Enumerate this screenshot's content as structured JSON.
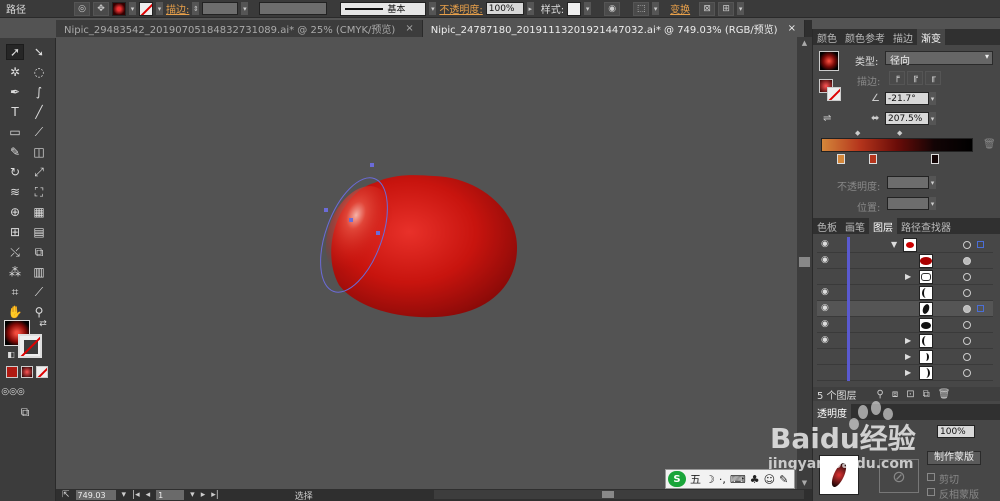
{
  "control_bar": {
    "object_type": "路径",
    "stroke_label": "描边:",
    "stroke_style": "基本",
    "opacity_label": "不透明度:",
    "opacity_value": "100%",
    "style_label": "样式:",
    "transform_label": "变换"
  },
  "tabs": [
    {
      "label": "Nipic_29483542_20190705184832731089.ai* @ 25% (CMYK/预览)",
      "close": "×"
    },
    {
      "label": "Nipic_24787180_20191113201921447032.ai* @ 749.03% (RGB/预览)",
      "close": "×"
    }
  ],
  "status_bar": {
    "zoom": "749.03",
    "page": "1",
    "tool": "选择"
  },
  "right_panel": {
    "top_tabs": [
      "颜色",
      "颜色参考",
      "描边",
      "渐变"
    ],
    "gradient": {
      "type_label": "类型:",
      "type_value": "径向",
      "stroke_label": "描边:",
      "angle": "-21.7°",
      "aspect": "207.5%",
      "opacity_label": "不透明度:",
      "location_label": "位置:",
      "colors": [
        "#d4873a",
        "#b5351c",
        "#6a0c08",
        "#120405",
        "#000000"
      ]
    },
    "layer_tabs": [
      "色板",
      "画笔",
      "图层",
      "路径查找器"
    ],
    "layers_count": "5 个图层",
    "transparency_tab": "透明度",
    "opacity_value": "100%",
    "make_mask": "制作蒙版",
    "clip_label": "剪切",
    "invert_label": "反相蒙版"
  },
  "ime": {
    "label": "五"
  },
  "watermark": {
    "brand": "Baidu经验",
    "url": "jingyan.baidu.com"
  },
  "colors": {
    "apple_light": "#e8312a",
    "apple_mid": "#c8140e",
    "apple_dark": "#8a0a08",
    "anchor": "#6b6bd8"
  }
}
